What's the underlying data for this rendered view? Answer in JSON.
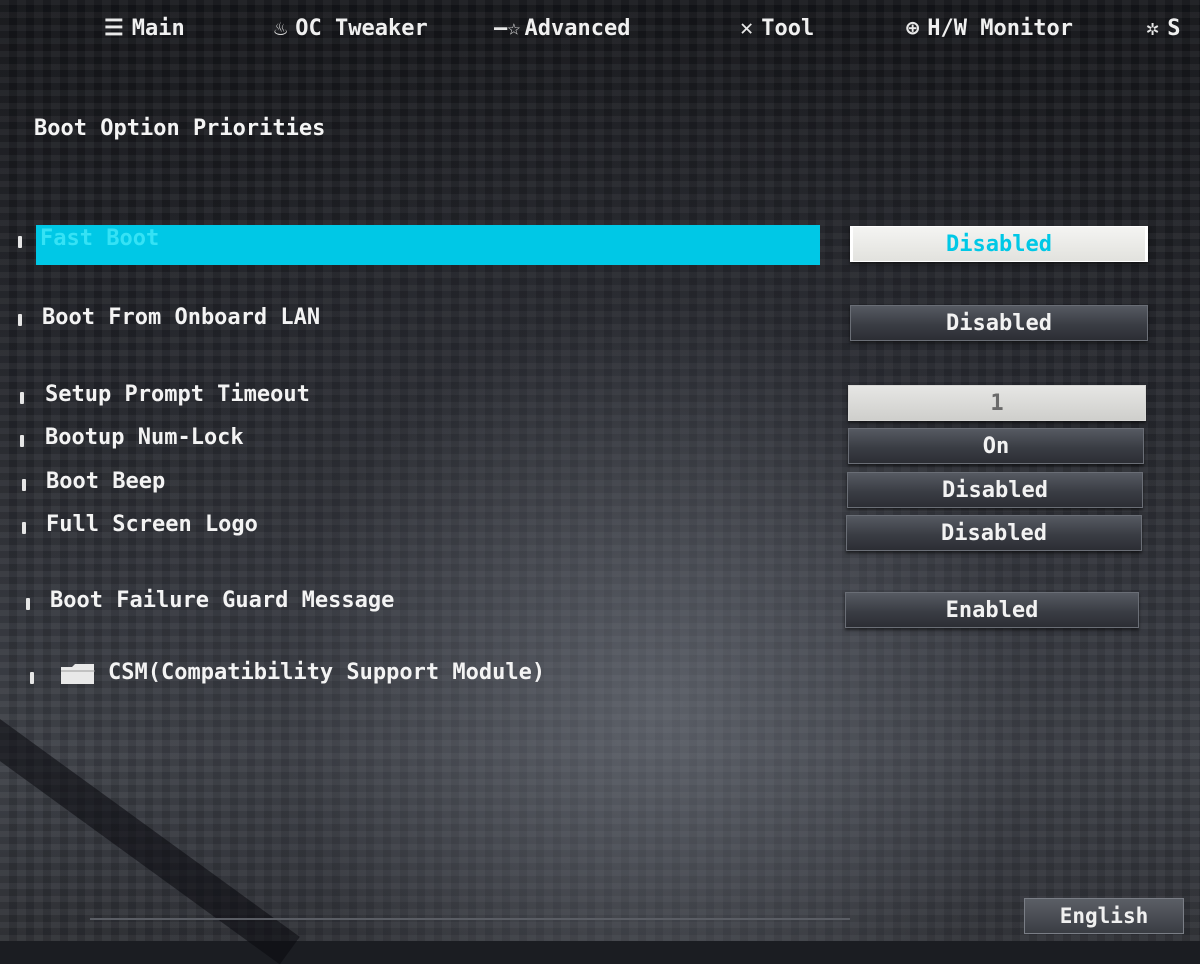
{
  "nav": {
    "tabs": [
      {
        "label": "Main",
        "icon": "list-icon"
      },
      {
        "label": "OC Tweaker",
        "icon": "flame-icon"
      },
      {
        "label": "Advanced",
        "icon": "star-icon"
      },
      {
        "label": "Tool",
        "icon": "wrench-screwdriver-icon"
      },
      {
        "label": "H/W Monitor",
        "icon": "crosshair-icon"
      },
      {
        "label": "S",
        "icon": "gear-icon"
      }
    ]
  },
  "page": {
    "title": "Boot Option Priorities"
  },
  "settings": [
    {
      "label": "Fast Boot",
      "value": "Disabled"
    },
    {
      "label": "Boot From Onboard LAN",
      "value": "Disabled"
    },
    {
      "label": "Setup Prompt Timeout",
      "value": "1"
    },
    {
      "label": "Bootup Num-Lock",
      "value": "On"
    },
    {
      "label": "Boot Beep",
      "value": "Disabled"
    },
    {
      "label": "Full Screen Logo",
      "value": "Disabled"
    },
    {
      "label": "Boot Failure Guard Message",
      "value": "Enabled"
    }
  ],
  "submenu": {
    "label": "CSM(Compatibility Support Module)",
    "icon": "folder-icon"
  },
  "footer": {
    "language": "English"
  },
  "colors": {
    "highlight": "#00c8e6",
    "text": "#f2f2f2"
  }
}
